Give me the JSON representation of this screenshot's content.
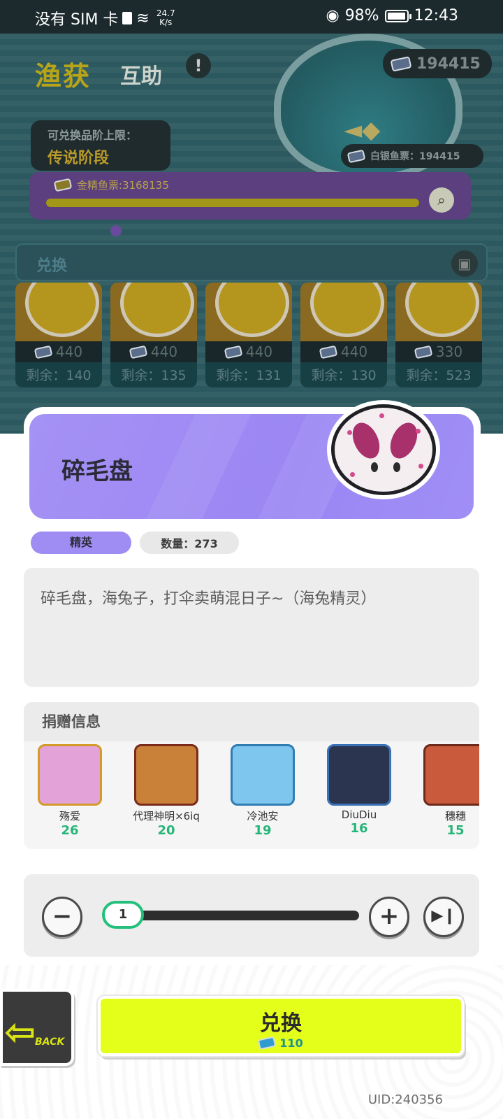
{
  "status": {
    "carrier": "没有 SIM 卡",
    "speed_value": "24.7",
    "speed_unit": "K/s",
    "battery": "98%",
    "battery_level": 0.98,
    "time": "12:43"
  },
  "background": {
    "title_main": "渔获",
    "title_sub": "互助",
    "balance_top": "194415",
    "tier_label": "可兑换品阶上限：",
    "tier_value": "传说阶段",
    "silver_label": "白银鱼票：194415",
    "gold_label": "金精鱼票:3168135",
    "gold_progress": 1.0,
    "exchange_tab": "兑换",
    "items": [
      {
        "price": "440",
        "remaining": "剩余：140"
      },
      {
        "price": "440",
        "remaining": "剩余：135"
      },
      {
        "price": "440",
        "remaining": "剩余：131"
      },
      {
        "price": "440",
        "remaining": "剩余：130"
      },
      {
        "price": "330",
        "remaining": "剩余：523"
      }
    ]
  },
  "detail": {
    "name": "碎毛盘",
    "grade": "精英",
    "quantity_label": "数量：273",
    "description": "碎毛盘，海兔子，打伞卖萌混日子~（海兔精灵）",
    "donation_title": "捐赠信息",
    "donors": [
      {
        "name": "殇爱",
        "amount": "26",
        "color": "#e3a2d8"
      },
      {
        "name": "代理神明×6iq",
        "amount": "20",
        "color": "#c9813a"
      },
      {
        "name": "冷池安",
        "amount": "19",
        "color": "#7fc6ef"
      },
      {
        "name": "DiuDiu",
        "amount": "16",
        "color": "#2c3550"
      },
      {
        "name": "穗穗",
        "amount": "15",
        "color": "#c95a3b"
      }
    ],
    "quantity_value": "1",
    "minus_symbol": "−",
    "plus_symbol": "+",
    "max_symbol": "▶❙"
  },
  "actions": {
    "back_label": "BACK",
    "exchange_label": "兑换",
    "exchange_cost": "110"
  },
  "uid": "UID:240356",
  "colors": {
    "accent_purple": "#9b86f3",
    "button_yellow": "#e4ff1a",
    "slider_green": "#22c07a",
    "amount_green": "#26b578"
  }
}
